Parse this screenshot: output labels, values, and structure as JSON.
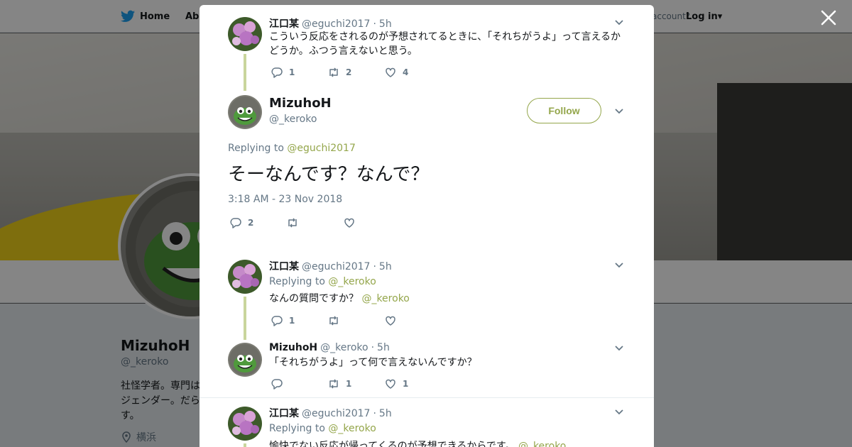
{
  "nav": {
    "home": "Home",
    "about": "Abo",
    "account": "account?",
    "login": "Log in"
  },
  "profile": {
    "name": "MizuhoH",
    "handle": "@_keroko",
    "bio": "社怪学者。専門はジェンダー。だらす。",
    "location": "横浜"
  },
  "thread": [
    {
      "name": "江口某",
      "handle": "@eguchi2017",
      "time": "5h",
      "text": "こういう反応をされるのが予想されてるときに、「それちがうよ」って言えるかどうか。ふつう言えないと思う。",
      "replies": "1",
      "retweets": "2",
      "likes": "4"
    }
  ],
  "main_tweet": {
    "name": "MizuhoH",
    "handle": "@_keroko",
    "follow_label": "Follow",
    "replying_prefix": "Replying to",
    "replying_to": "@eguchi2017",
    "text": "そーなんです？なんで？",
    "timestamp": "3:18 AM - 23 Nov 2018",
    "replies": "2",
    "retweets": "",
    "likes": ""
  },
  "replies": [
    {
      "name": "江口某",
      "handle": "@eguchi2017",
      "time": "5h",
      "replying_prefix": "Replying to",
      "replying_to": "@_keroko",
      "text": "なんの質問ですか？",
      "mention": "@_keroko",
      "replies": "1",
      "retweets": "",
      "likes": ""
    },
    {
      "name": "MizuhoH",
      "handle": "@_keroko",
      "time": "5h",
      "text": "「それちがうよ」って何で言えないんですか？",
      "replies": "",
      "retweets": "1",
      "likes": "1"
    },
    {
      "name": "江口某",
      "handle": "@eguchi2017",
      "time": "5h",
      "replying_prefix": "Replying to",
      "replying_to": "@_keroko",
      "text": "愉快でない反応が帰ってくるのが予想できるからです。",
      "mention": "@_keroko"
    }
  ],
  "colors": {
    "accent": "#94a64b",
    "thread_line": "#c9d59c",
    "muted": "#657786"
  },
  "icons": [
    "twitter-bird-icon",
    "close-icon",
    "reply-icon",
    "retweet-icon",
    "like-icon",
    "chevron-down-icon",
    "location-pin-icon"
  ]
}
